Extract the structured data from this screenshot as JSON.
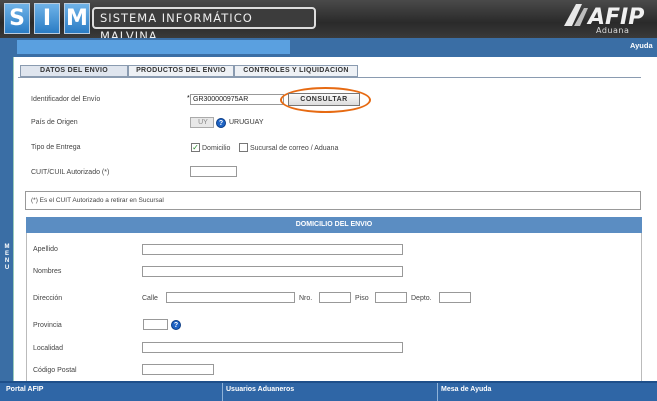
{
  "header": {
    "logo_letters": [
      "S",
      "I",
      "M"
    ],
    "system_title": "SISTEMA INFORMÁTICO MALVINA",
    "brand": "AFIP",
    "brand_sub": "Aduana"
  },
  "topbar": {
    "help_label": "Ayuda"
  },
  "sidebar": {
    "label": "MENU"
  },
  "tabs": [
    {
      "label": "DATOS DEL ENVIO",
      "active": true
    },
    {
      "label": "PRODUCTOS DEL ENVIO",
      "active": false
    },
    {
      "label": "CONTROLES Y LIQUIDACION",
      "active": false
    }
  ],
  "form": {
    "shipment_id": {
      "label": "Identificador del Envío",
      "required_mark": "*",
      "value": "GR300000975AR"
    },
    "consult_button": "CONSULTAR",
    "origin_country": {
      "label": "País de Origen",
      "code": "UY",
      "name": "URUGUAY"
    },
    "delivery_type": {
      "label": "Tipo de Entrega",
      "options": [
        {
          "label": "Domicilio",
          "checked": true
        },
        {
          "label": "Sucursal de correo / Aduana",
          "checked": false
        }
      ]
    },
    "authorized_cuit": {
      "label": "CUIT/CUIL Autorizado (*)",
      "value": ""
    },
    "note": "(*) Es el CUIT Autorizado a retirar en Sucursal"
  },
  "address_section": {
    "title": "DOMICILIO DEL ENVIO",
    "surname_label": "Apellido",
    "names_label": "Nombres",
    "address_label": "Dirección",
    "street_label": "Calle",
    "number_label": "Nro.",
    "floor_label": "Piso",
    "apt_label": "Depto.",
    "province_label": "Provincia",
    "locality_label": "Localidad",
    "postal_code_label": "Código Postal"
  },
  "footer": {
    "items": [
      "Portal AFIP",
      "Usuarios Aduaneros",
      "Mesa de Ayuda"
    ]
  },
  "colors": {
    "header_bg": "#3a3a3a",
    "primary_blue": "#3a6ea5",
    "section_blue": "#5b8dc2",
    "highlight_orange": "#e66a12"
  }
}
